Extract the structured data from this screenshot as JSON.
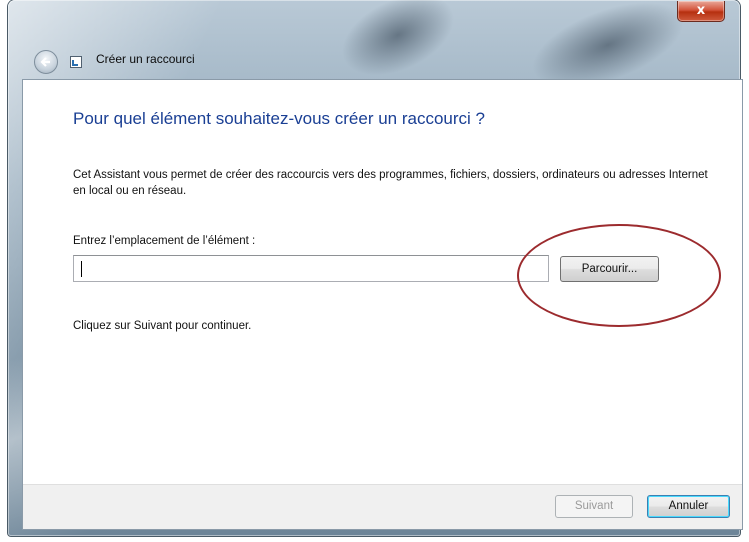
{
  "window": {
    "title": "Créer un raccourci",
    "close_label": "x",
    "icons": {
      "back": "back-arrow-icon",
      "app": "shortcut-icon",
      "close": "close-icon"
    }
  },
  "main": {
    "heading": "Pour quel élément souhaitez-vous créer un raccourci ?",
    "description": "Cet Assistant vous permet de créer des raccourcis vers des programmes, fichiers, dossiers, ordinateurs ou adresses Internet en local ou en réseau.",
    "location_label": "Entrez l’emplacement de l’élément :",
    "location_value": "",
    "browse_label": "Parcourir...",
    "continue_text": "Cliquez sur Suivant pour continuer."
  },
  "footer": {
    "next_label": "Suivant",
    "cancel_label": "Annuler"
  },
  "colors": {
    "heading": "#1a3f94",
    "highlight": "#9c2b2e",
    "close": "#c6401f"
  }
}
